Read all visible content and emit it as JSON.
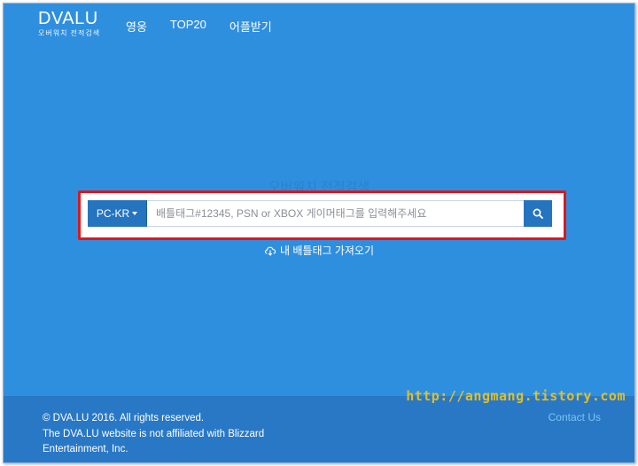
{
  "brand": {
    "name": "DVALU",
    "subtitle": "오버워치 전적검색"
  },
  "nav": {
    "items": [
      {
        "label": "영웅"
      },
      {
        "label": "TOP20"
      },
      {
        "label": "어플받기"
      }
    ]
  },
  "hero": {
    "title": "오버워치 전적검색"
  },
  "search": {
    "platform": "PC-KR",
    "placeholder": "배틀태그#12345, PSN or XBOX 게이머태그를 입력해주세요",
    "value": ""
  },
  "import": {
    "label": "내 배틀태그 가져오기"
  },
  "footer": {
    "lines": [
      "© DVA.LU 2016. All rights reserved.",
      "The DVA.LU website is not affiliated with Blizzard",
      "Entertainment, Inc."
    ],
    "contact": "Contact Us"
  },
  "watermark": "http://angmang.tistory.com",
  "colors": {
    "background": "#2f8fdf",
    "footer": "#2978c6",
    "highlight": "#e0161b",
    "contact": "#7dc4f0",
    "watermark": "#f0c419"
  }
}
